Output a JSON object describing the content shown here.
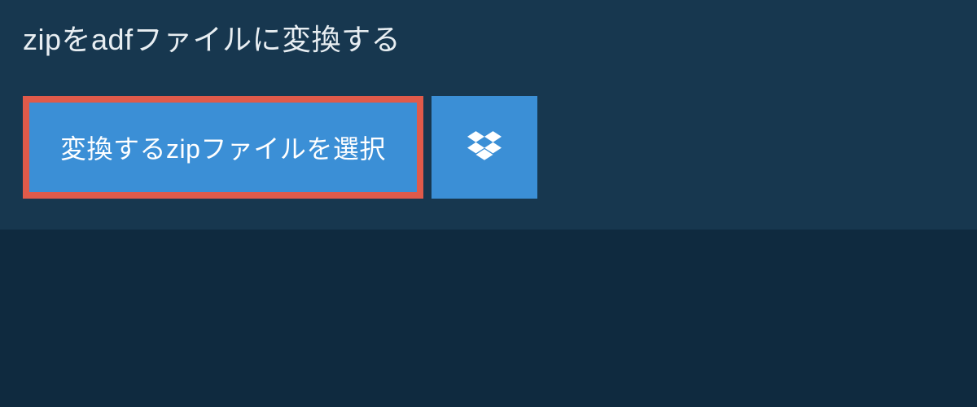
{
  "heading": "zipをadfファイルに変換する",
  "select_button_label": "変換するzipファイルを選択",
  "icons": {
    "dropbox": "dropbox-icon"
  },
  "colors": {
    "background": "#0f2a3f",
    "panel": "#17374f",
    "button": "#3b8fd6",
    "highlight_border": "#e05a4a",
    "text": "#ffffff"
  }
}
